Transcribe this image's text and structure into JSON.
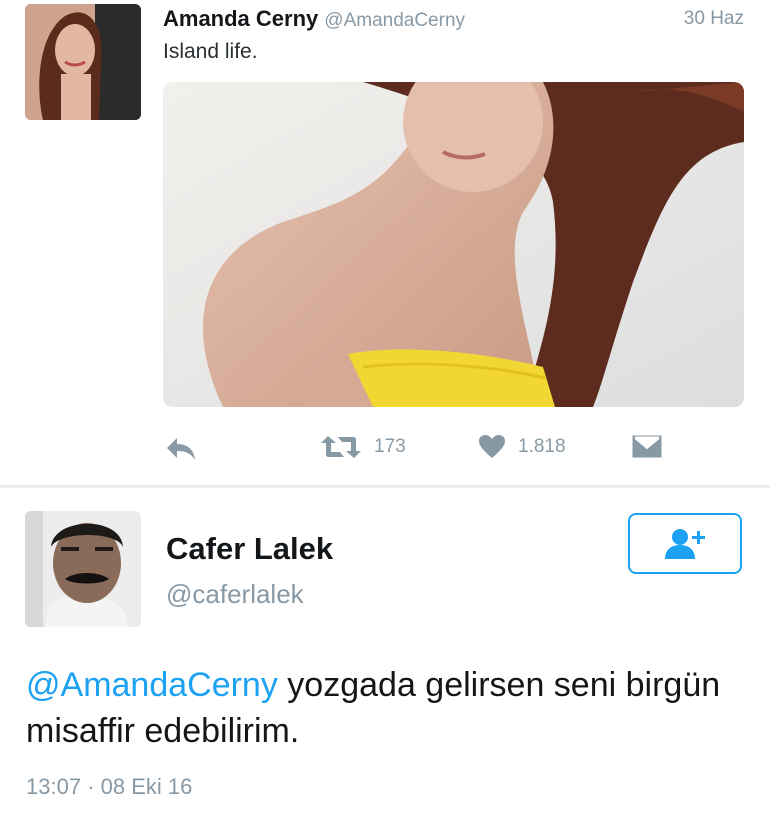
{
  "original_tweet": {
    "author_name": "Amanda Cerny",
    "author_handle": "@AmandaCerny",
    "date": "30 Haz",
    "text": "Island life.",
    "retweet_count": "173",
    "like_count": "1.818",
    "icons": [
      "reply-icon",
      "retweet-icon",
      "heart-icon",
      "envelope-icon"
    ]
  },
  "reply": {
    "author_name": "Cafer Lalek",
    "author_handle": "@caferlalek",
    "mention": "@AmandaCerny",
    "text": " yozgada gelirsen seni birgün misaffir edebilirim.",
    "timestamp": "13:07 · 08 Eki 16",
    "follow_icon": "follow-user-icon"
  },
  "colors": {
    "accent": "#1da1f2",
    "muted": "#8899a6",
    "text": "#14171a"
  }
}
